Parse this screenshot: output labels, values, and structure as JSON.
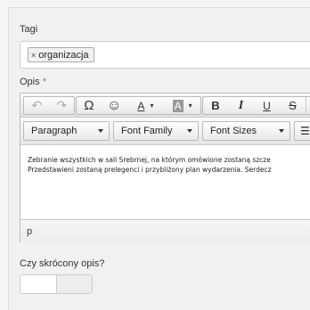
{
  "form": {
    "tags_label": "Tagi",
    "tags": [
      {
        "text": "organizacja",
        "remove_icon": "×"
      }
    ],
    "description_label": "Opis",
    "required_mark": "*",
    "short_desc_label": "Czy skrócony opis?"
  },
  "editor": {
    "toolbar_icons": {
      "undo": "↶",
      "redo": "↷",
      "omega": "Ω",
      "emoticon": "☺",
      "text_color": "A",
      "bg_color": "A",
      "bold": "B",
      "italic": "I",
      "underline": "U",
      "strikethrough": "S"
    },
    "block_format": "Paragraph",
    "font_family": "Font Family",
    "font_size": "Font Sizes",
    "content_lines": [
      "Zebranie wszystkich w sali Srebrnej, na którym omówione zostaną szcze",
      "Przedstawieni zostaną prelegenci i przybliżony plan wydarzenia. Serdecz"
    ],
    "status_path": "p"
  }
}
